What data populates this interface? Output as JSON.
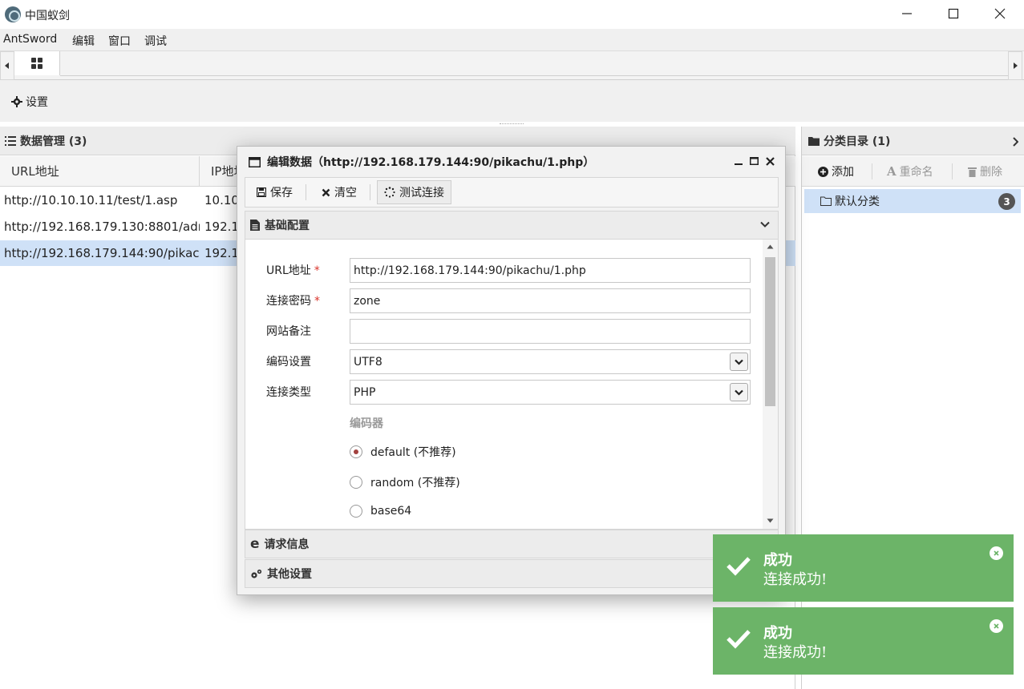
{
  "window": {
    "title": "中国蚁剑"
  },
  "menu": [
    "AntSword",
    "编辑",
    "窗口",
    "调试"
  ],
  "toolbar": {
    "settings_label": "设置"
  },
  "data_panel": {
    "title": "数据管理 (3)",
    "columns": [
      "URL地址",
      "IP地址"
    ],
    "rows": [
      {
        "url": "http://10.10.10.11/test/1.asp",
        "ip": "10.10"
      },
      {
        "url": "http://192.168.179.130:8801/adm",
        "ip": "192.1"
      },
      {
        "url": "http://192.168.179.144:90/pikach",
        "ip": "192.1"
      }
    ]
  },
  "category_panel": {
    "title": "分类目录 (1)",
    "add_label": "添加",
    "rename_label": "重命名",
    "delete_label": "删除",
    "item_label": "默认分类",
    "item_count": "3"
  },
  "modal": {
    "title": "编辑数据（http://192.168.179.144:90/pikachu/1.php）",
    "save_label": "保存",
    "clear_label": "清空",
    "test_label": "测试连接",
    "basic_section": "基础配置",
    "request_section": "请求信息",
    "other_section": "其他设置",
    "fields": {
      "url_label": "URL地址",
      "url_value": "http://192.168.179.144:90/pikachu/1.php",
      "password_label": "连接密码",
      "password_value": "zone",
      "note_label": "网站备注",
      "note_value": "",
      "encoding_label": "编码设置",
      "encoding_value": "UTF8",
      "type_label": "连接类型",
      "type_value": "PHP",
      "required_mark": "*"
    },
    "encoder": {
      "label": "编码器",
      "options": [
        "default (不推荐)",
        "random (不推荐)",
        "base64"
      ],
      "selected": "default (不推荐)"
    }
  },
  "toasts": [
    {
      "title": "成功",
      "message": "连接成功!"
    },
    {
      "title": "成功",
      "message": "连接成功!"
    }
  ],
  "colors": {
    "selection": "#cfe1f7",
    "toast": "#6cb468",
    "required": "#d9342b",
    "badge": "#555555"
  }
}
